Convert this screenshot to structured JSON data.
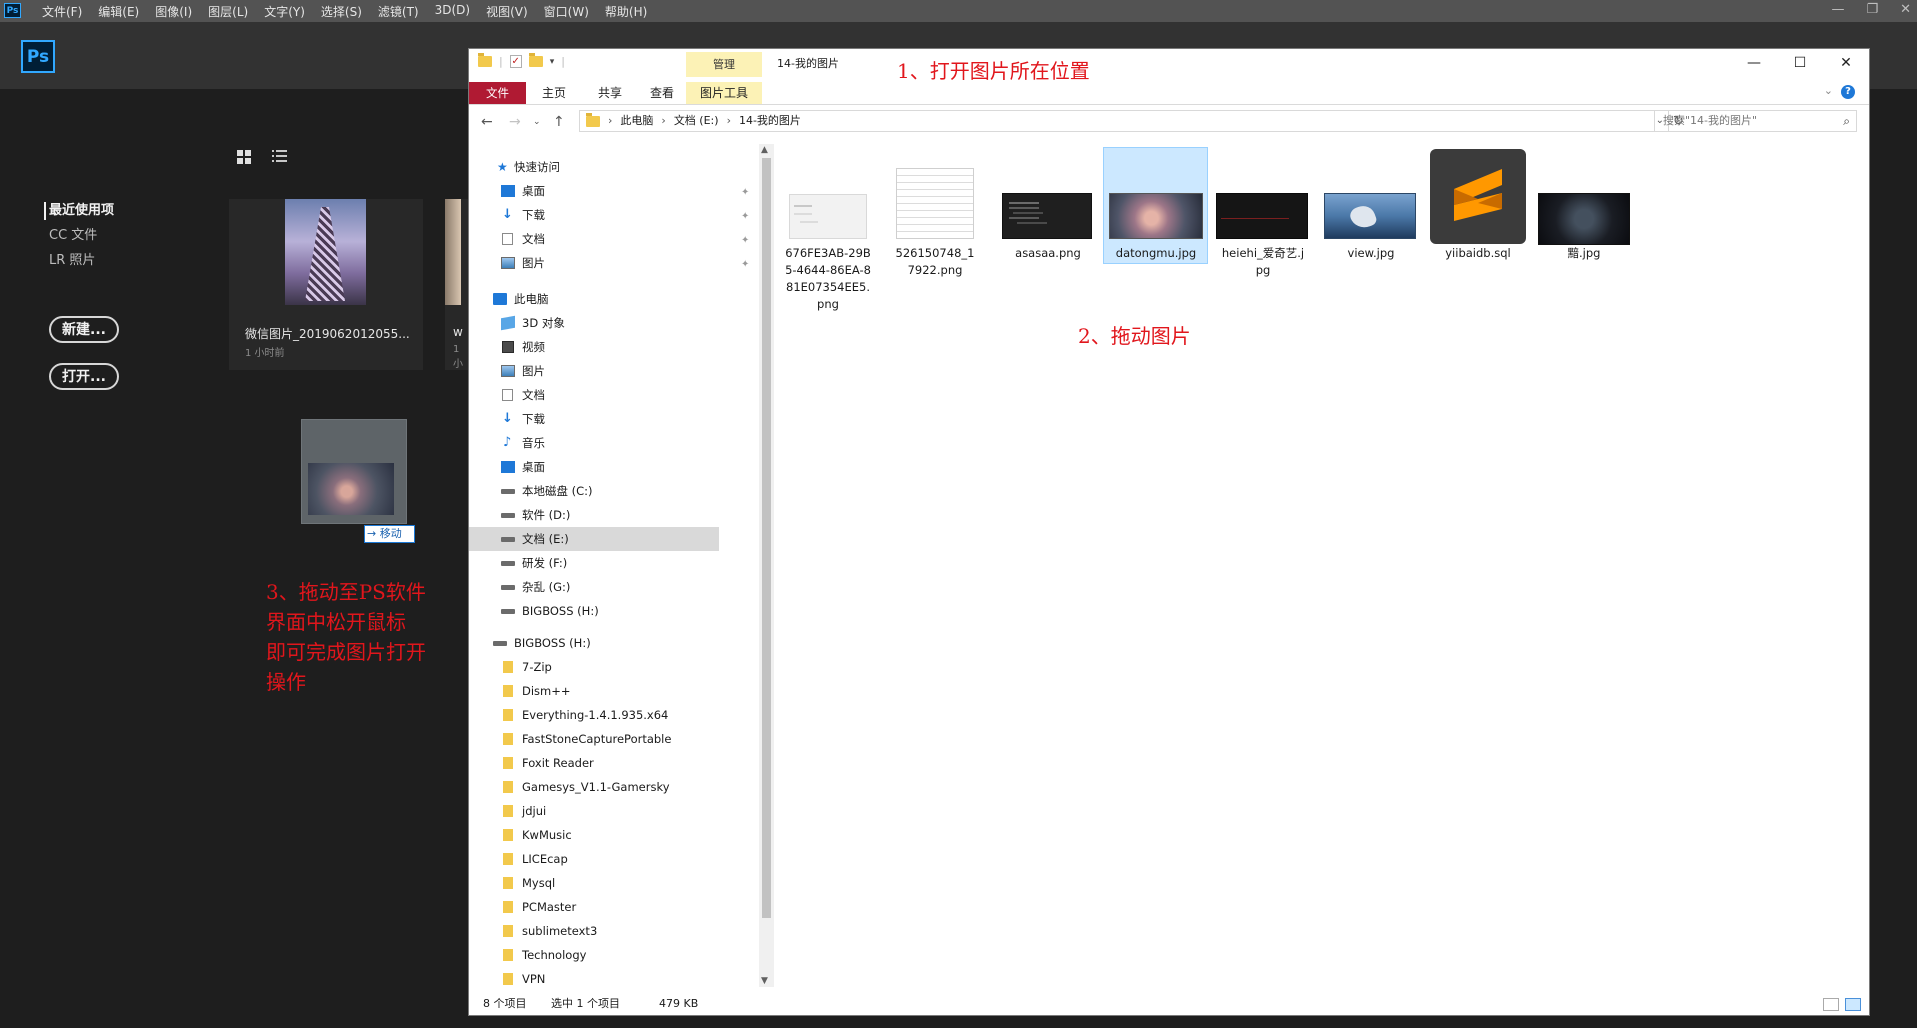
{
  "ps": {
    "logo": "Ps",
    "menu": [
      "文件(F)",
      "编辑(E)",
      "图像(I)",
      "图层(L)",
      "文字(Y)",
      "选择(S)",
      "滤镜(T)",
      "3D(D)",
      "视图(V)",
      "窗口(W)",
      "帮助(H)"
    ],
    "window_controls": [
      "—",
      "❐",
      "✕"
    ],
    "nav": {
      "recent": "最近使用项",
      "cc_files": "CC 文件",
      "lr_photos": "LR 照片"
    },
    "buttons": {
      "new": "新建...",
      "open": "打开..."
    },
    "recent_files": [
      {
        "title": "微信图片_2019062012055...",
        "sub": "1 小时前"
      },
      {
        "title": "w",
        "sub": "1 小"
      }
    ],
    "drag_tooltip": "→ 移动"
  },
  "annotations": {
    "step1": "1、打开图片所在位置",
    "step2": "2、拖动图片",
    "step3": [
      "3、拖动至PS软件",
      "界面中松开鼠标",
      "即可完成图片打开",
      "操作"
    ]
  },
  "explorer": {
    "caption": "14-我的图片",
    "context_tab_top": "管理",
    "window_controls": [
      "—",
      "☐",
      "✕"
    ],
    "ribbon_tabs": [
      "文件",
      "主页",
      "共享",
      "查看",
      "图片工具"
    ],
    "help": "?",
    "path": [
      "此电脑",
      "文档 (E:)",
      "14-我的图片"
    ],
    "search_placeholder": "搜索\"14-我的图片\"",
    "nav": [
      {
        "label": "快速访问",
        "icon": "star-icon"
      },
      {
        "label": "桌面",
        "icon": "desktop-icon",
        "pinned": true
      },
      {
        "label": "下载",
        "icon": "download-icon",
        "pinned": true
      },
      {
        "label": "文档",
        "icon": "document-icon",
        "pinned": true
      },
      {
        "label": "图片",
        "icon": "picture-icon",
        "pinned": true
      },
      {
        "label": "此电脑",
        "icon": "pc-icon"
      },
      {
        "label": "3D 对象",
        "icon": "3d-objects-icon"
      },
      {
        "label": "视频",
        "icon": "video-icon"
      },
      {
        "label": "图片",
        "icon": "picture-icon"
      },
      {
        "label": "文档",
        "icon": "document-icon"
      },
      {
        "label": "下载",
        "icon": "download-icon"
      },
      {
        "label": "音乐",
        "icon": "music-icon"
      },
      {
        "label": "桌面",
        "icon": "desktop-icon"
      },
      {
        "label": "本地磁盘 (C:)",
        "icon": "drive-icon"
      },
      {
        "label": "软件 (D:)",
        "icon": "drive-icon"
      },
      {
        "label": "文档 (E:)",
        "icon": "drive-icon",
        "selected": true
      },
      {
        "label": "研发 (F:)",
        "icon": "drive-icon"
      },
      {
        "label": "杂乱 (G:)",
        "icon": "drive-icon"
      },
      {
        "label": "BIGBOSS (H:)",
        "icon": "drive-icon"
      },
      {
        "label": "BIGBOSS (H:)",
        "icon": "drive-icon"
      },
      {
        "label": "7-Zip",
        "icon": "folder-icon"
      },
      {
        "label": "Dism++",
        "icon": "folder-icon"
      },
      {
        "label": "Everything-1.4.1.935.x64",
        "icon": "folder-icon"
      },
      {
        "label": "FastStoneCapturePortable",
        "icon": "folder-icon"
      },
      {
        "label": "Foxit Reader",
        "icon": "folder-icon"
      },
      {
        "label": "Gamesys_V1.1-Gamersky",
        "icon": "folder-icon"
      },
      {
        "label": "jdjui",
        "icon": "folder-icon"
      },
      {
        "label": "KwMusic",
        "icon": "folder-icon"
      },
      {
        "label": "LICEcap",
        "icon": "folder-icon"
      },
      {
        "label": "Mysql",
        "icon": "folder-icon"
      },
      {
        "label": "PCMaster",
        "icon": "folder-icon"
      },
      {
        "label": "sublimetext3",
        "icon": "folder-icon"
      },
      {
        "label": "Technology",
        "icon": "folder-icon"
      },
      {
        "label": "VPN",
        "icon": "folder-icon"
      }
    ],
    "files": [
      {
        "name": "676FE3AB-29B5-4644-86EA-881E07354EE5.png",
        "thumb": "doc"
      },
      {
        "name": "526150748_17922.png",
        "thumb": "diag"
      },
      {
        "name": "asasaa.png",
        "thumb": "dark"
      },
      {
        "name": "datongmu.jpg",
        "thumb": "art",
        "selected": true
      },
      {
        "name": "heiehi_爱奇艺.jpg",
        "thumb": "heie"
      },
      {
        "name": "view.jpg",
        "thumb": "view"
      },
      {
        "name": "yiibaidb.sql",
        "thumb": "sql"
      },
      {
        "name": "黯.jpg",
        "thumb": "girl"
      }
    ],
    "status": {
      "count": "8 个项目",
      "selected": "选中 1 个项目",
      "size": "479 KB"
    }
  }
}
